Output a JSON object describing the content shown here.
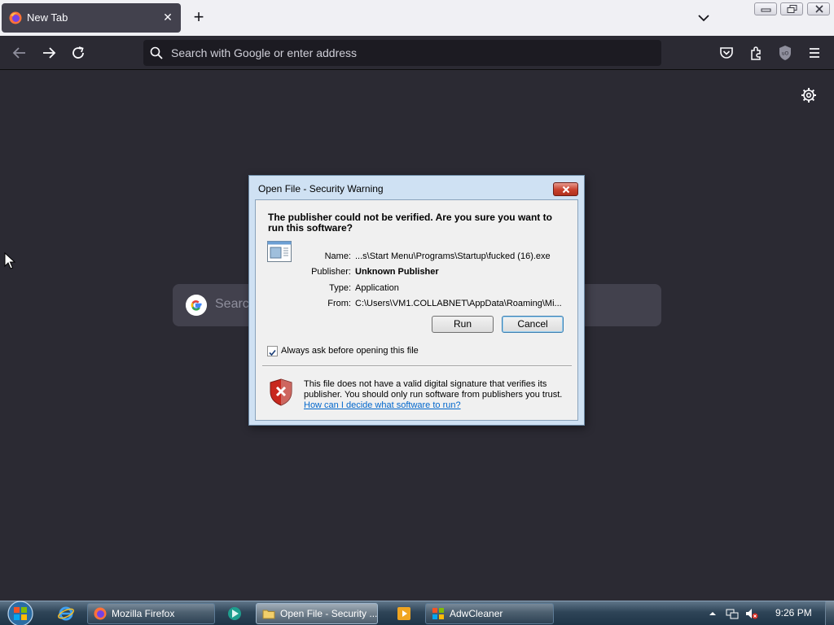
{
  "browser": {
    "tab": {
      "title": "New Tab",
      "close_glyph": "✕"
    },
    "newtab_glyph": "+",
    "url_placeholder": "Search with Google or enter address"
  },
  "newtab_page": {
    "search_placeholder": "Search"
  },
  "dialog": {
    "title": "Open File - Security Warning",
    "heading": "The publisher could not be verified.  Are you sure you want to run this software?",
    "fields": [
      {
        "label": "Name:",
        "value": "...s\\Start Menu\\Programs\\Startup\\fucked (16).exe"
      },
      {
        "label": "Publisher:",
        "value": "Unknown Publisher"
      },
      {
        "label": "Type:",
        "value": "Application"
      },
      {
        "label": "From:",
        "value": "C:\\Users\\VM1.COLLABNET\\AppData\\Roaming\\Mi..."
      }
    ],
    "run_label": "Run",
    "cancel_label": "Cancel",
    "checkbox_label": "Always ask before opening this file",
    "checkbox_checked": true,
    "footer_text": "This file does not have a valid digital signature that verifies its publisher.  You should only run software from publishers you trust.",
    "footer_link": "How can I decide what software to run?"
  },
  "taskbar": {
    "buttons": [
      {
        "label": "Mozilla Firefox",
        "icon": "firefox-icon"
      },
      {
        "label": "Open File - Security ...",
        "icon": "folder-icon"
      },
      {
        "label": "AdwCleaner",
        "icon": "adwcleaner-icon"
      }
    ],
    "clock": "9:26 PM"
  },
  "colors": {
    "browser_bg": "#2b2a33",
    "tabstrip_bg": "#f0f0f4",
    "dialog_frame": "#cfe1f3",
    "link": "#0066cc"
  }
}
